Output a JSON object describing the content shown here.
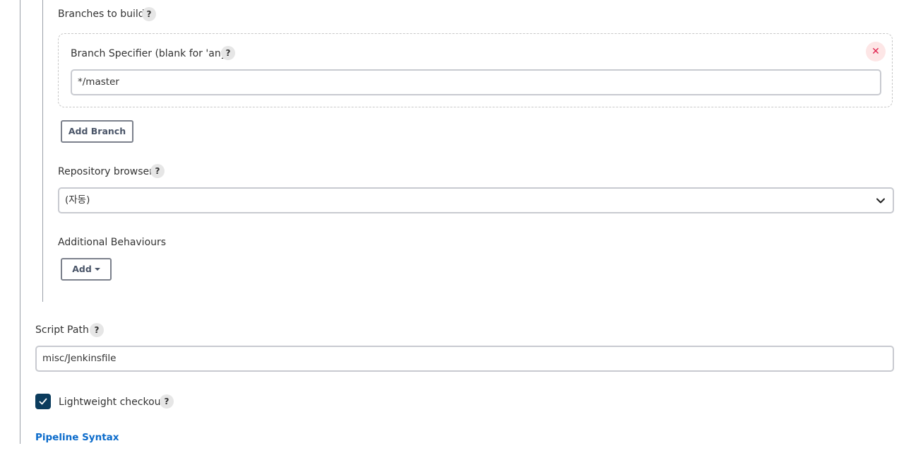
{
  "branches": {
    "section_label": "Branches to build",
    "help_symbol": "?",
    "specifier_label": "Branch Specifier (blank for 'any')",
    "specifier_value": "*/master",
    "remove_symbol": "✕",
    "add_button_label": "Add Branch"
  },
  "repository_browser": {
    "label": "Repository browser",
    "help_symbol": "?",
    "selected_value": "(자동)"
  },
  "additional_behaviours": {
    "label": "Additional Behaviours",
    "add_button_label": "Add"
  },
  "script_path": {
    "label": "Script Path",
    "help_symbol": "?",
    "value": "misc/Jenkinsfile"
  },
  "lightweight_checkout": {
    "label": "Lightweight checkout",
    "help_symbol": "?",
    "checked": true
  },
  "pipeline_syntax_link": "Pipeline Syntax",
  "colors": {
    "checkbox_fill": "#0b3c5d",
    "link": "#0b6bcb",
    "remove_button": "#e0234e"
  }
}
